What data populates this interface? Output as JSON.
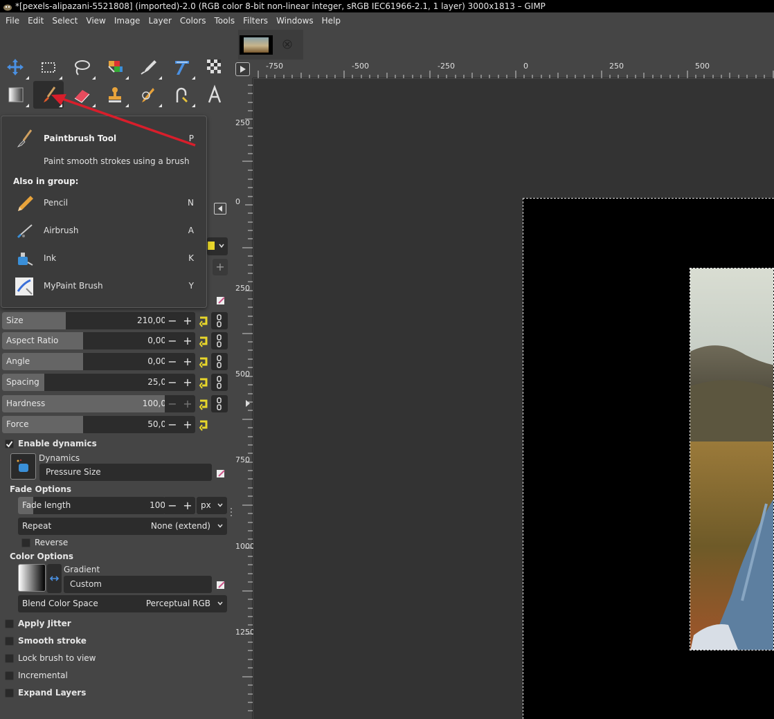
{
  "window": {
    "title": "*[pexels-alipazani-5521808] (imported)-2.0 (RGB color 8-bit non-linear integer, sRGB IEC61966-2.1, 1 layer) 3000x1813 – GIMP"
  },
  "menu": [
    "File",
    "Edit",
    "Select",
    "View",
    "Image",
    "Layer",
    "Colors",
    "Tools",
    "Filters",
    "Windows",
    "Help"
  ],
  "tools": [
    {
      "name": "move-tool",
      "icon": "move-icon"
    },
    {
      "name": "rect-select-tool",
      "icon": "rect-select-icon"
    },
    {
      "name": "free-select-tool",
      "icon": "lasso-icon"
    },
    {
      "name": "foreground-select-tool",
      "icon": "fg-select-icon"
    },
    {
      "name": "paths-tool",
      "icon": "pen-nib-icon"
    },
    {
      "name": "color-picker-tool",
      "icon": "measure-icon"
    },
    {
      "name": "crop-tool",
      "icon": "checker-icon"
    },
    {
      "name": "gradient-tool",
      "icon": "gradient-icon"
    },
    {
      "name": "paintbrush-tool",
      "icon": "paintbrush-icon"
    },
    {
      "name": "eraser-tool",
      "icon": "eraser-icon"
    },
    {
      "name": "clone-tool",
      "icon": "stamp-icon"
    },
    {
      "name": "smudge-tool",
      "icon": "smudge-icon"
    },
    {
      "name": "dodge-tool",
      "icon": "dodge-icon"
    },
    {
      "name": "text-tool",
      "icon": "text-icon"
    }
  ],
  "tooltip": {
    "title": "Paintbrush Tool",
    "title_key": "P",
    "description": "Paint smooth strokes using a brush",
    "group_label": "Also in group:",
    "items": [
      {
        "name": "Pencil",
        "key": "N"
      },
      {
        "name": "Airbrush",
        "key": "A"
      },
      {
        "name": "Ink",
        "key": "K"
      },
      {
        "name": "MyPaint Brush",
        "key": "Y"
      }
    ]
  },
  "options": {
    "sliders": [
      {
        "label": "Size",
        "value": "210,00",
        "fraction": 0.36
      },
      {
        "label": "Aspect Ratio",
        "value": "0,00",
        "fraction": 0.46
      },
      {
        "label": "Angle",
        "value": "0,00",
        "fraction": 0.46
      },
      {
        "label": "Spacing",
        "value": "25,0",
        "fraction": 0.24
      },
      {
        "label": "Hardness",
        "value": "100,0",
        "fraction": 0.94
      },
      {
        "label": "Force",
        "value": "50,0",
        "fraction": 0.46
      }
    ],
    "enable_dynamics": "Enable dynamics",
    "dynamics_label": "Dynamics",
    "dynamics_value": "Pressure Size",
    "fade_options": "Fade Options",
    "fade_length_label": "Fade length",
    "fade_length_value": "100",
    "fade_unit": "px",
    "repeat_label": "Repeat",
    "repeat_value": "None (extend)",
    "reverse": "Reverse",
    "color_options": "Color Options",
    "gradient_label": "Gradient",
    "gradient_value": "Custom",
    "blend_label": "Blend Color Space",
    "blend_value": "Perceptual RGB",
    "apply_jitter": "Apply Jitter",
    "smooth_stroke": "Smooth stroke",
    "lock_brush": "Lock brush to view",
    "incremental": "Incremental",
    "expand_layers": "Expand Layers"
  },
  "ruler": {
    "h_labels": [
      "-750",
      "-500",
      "-250",
      "0",
      "250",
      "500"
    ],
    "v_labels": [
      "250",
      "0",
      "250",
      "500",
      "750",
      "1000",
      "1250"
    ]
  },
  "colors": {
    "accent_arrow": "#d81e2b",
    "panel": "#454545",
    "field": "#2c2c2c"
  }
}
